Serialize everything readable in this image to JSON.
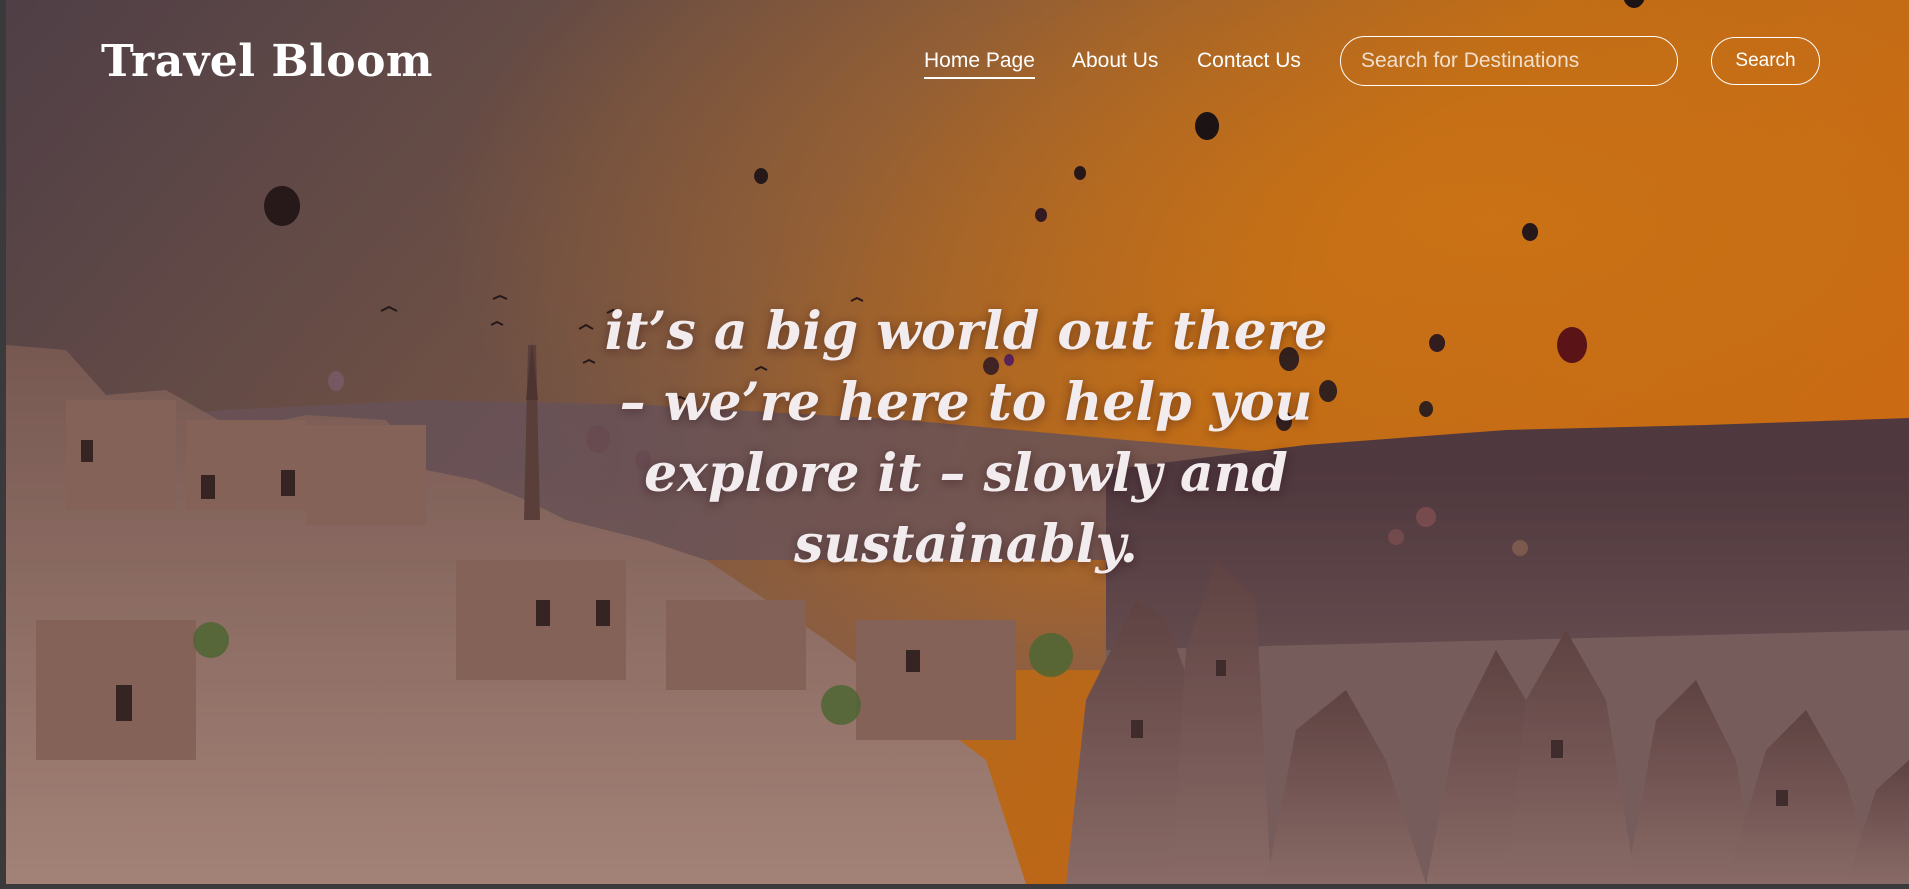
{
  "header": {
    "brand": "Travel Bloom",
    "nav": [
      {
        "label": "Home Page",
        "active": true
      },
      {
        "label": "About Us",
        "active": false
      },
      {
        "label": "Contact Us",
        "active": false
      }
    ],
    "search": {
      "placeholder": "Search for Destinations",
      "value": "",
      "button_label": "Search"
    }
  },
  "hero": {
    "tagline": "it’s a big world out there – we’re here to help you explore it – slowly and sustainably."
  },
  "background": {
    "scene": "Sunset over a cave-town landscape with hot air balloons and rock formations",
    "sky_top": "#5c4b51",
    "sky_glow": "#ec7a10",
    "ground": "#7a5a52"
  }
}
